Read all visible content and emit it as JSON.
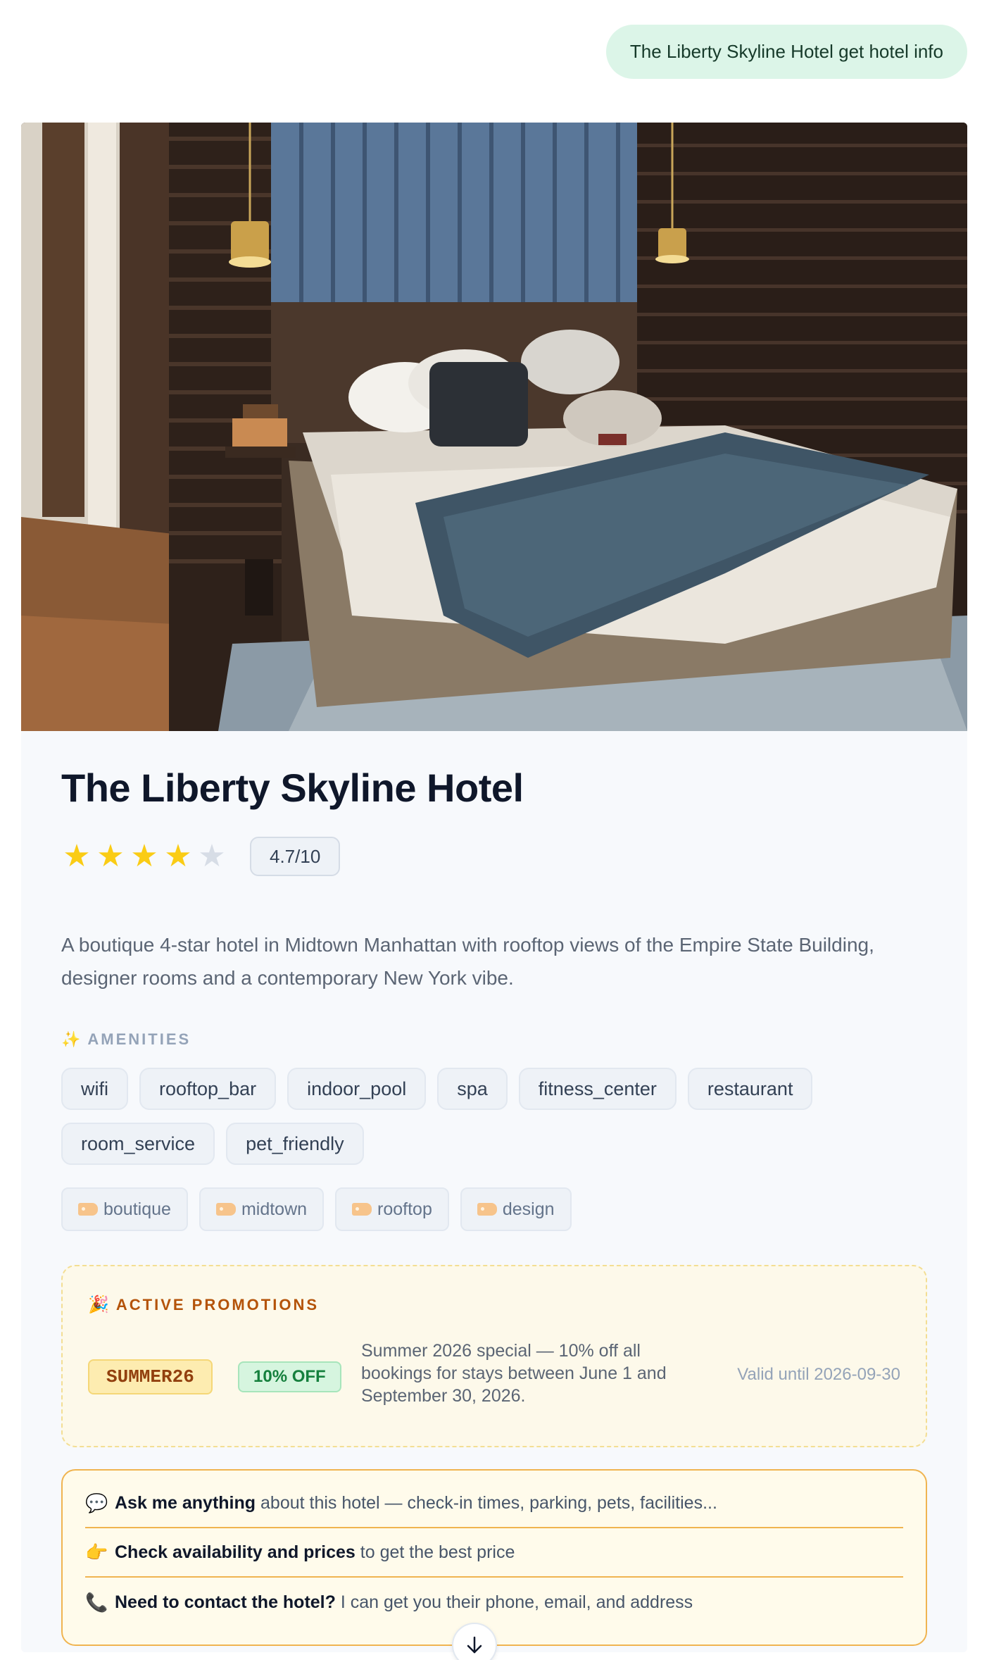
{
  "user_message": "The Liberty Skyline Hotel get hotel info",
  "hotel": {
    "name": "The Liberty Skyline Hotel",
    "stars": 4,
    "max_stars": 5,
    "score": "4.7/10",
    "description": "A boutique 4-star hotel in Midtown Manhattan with rooftop views of the Empire State Building, designer rooms and a contemporary New York vibe.",
    "hero_image_icon": "hotel-room-photo"
  },
  "amenities": {
    "label": "AMENITIES",
    "items": [
      "wifi",
      "rooftop_bar",
      "indoor_pool",
      "spa",
      "fitness_center",
      "restaurant",
      "room_service",
      "pet_friendly"
    ]
  },
  "tags": [
    "boutique",
    "midtown",
    "rooftop",
    "design"
  ],
  "promotions": {
    "label": "ACTIVE PROMOTIONS",
    "code": "SUMMER26",
    "discount": "10% OFF",
    "text": "Summer 2026 special — 10% off all bookings for stays between June 1 and September 30, 2026.",
    "valid": "Valid until 2026-09-30"
  },
  "prompts": [
    {
      "icon": "speech-bubble-icon",
      "bold": "Ask me anything",
      "rest": " about this hotel — check-in times, parking, pets, facilities..."
    },
    {
      "icon": "pointing-hand-icon",
      "bold": "Check availability and prices",
      "rest": " to get the best price"
    },
    {
      "icon": "telephone-icon",
      "bold": "Need to contact the hotel?",
      "rest": " I can get you their phone, email, and address"
    }
  ],
  "colors": {
    "star_filled": "#facc15",
    "star_empty": "#d7dde6",
    "user_bubble": "#dcf5e8",
    "promo_accent": "#b45309",
    "prompt_border": "#f0b450"
  }
}
